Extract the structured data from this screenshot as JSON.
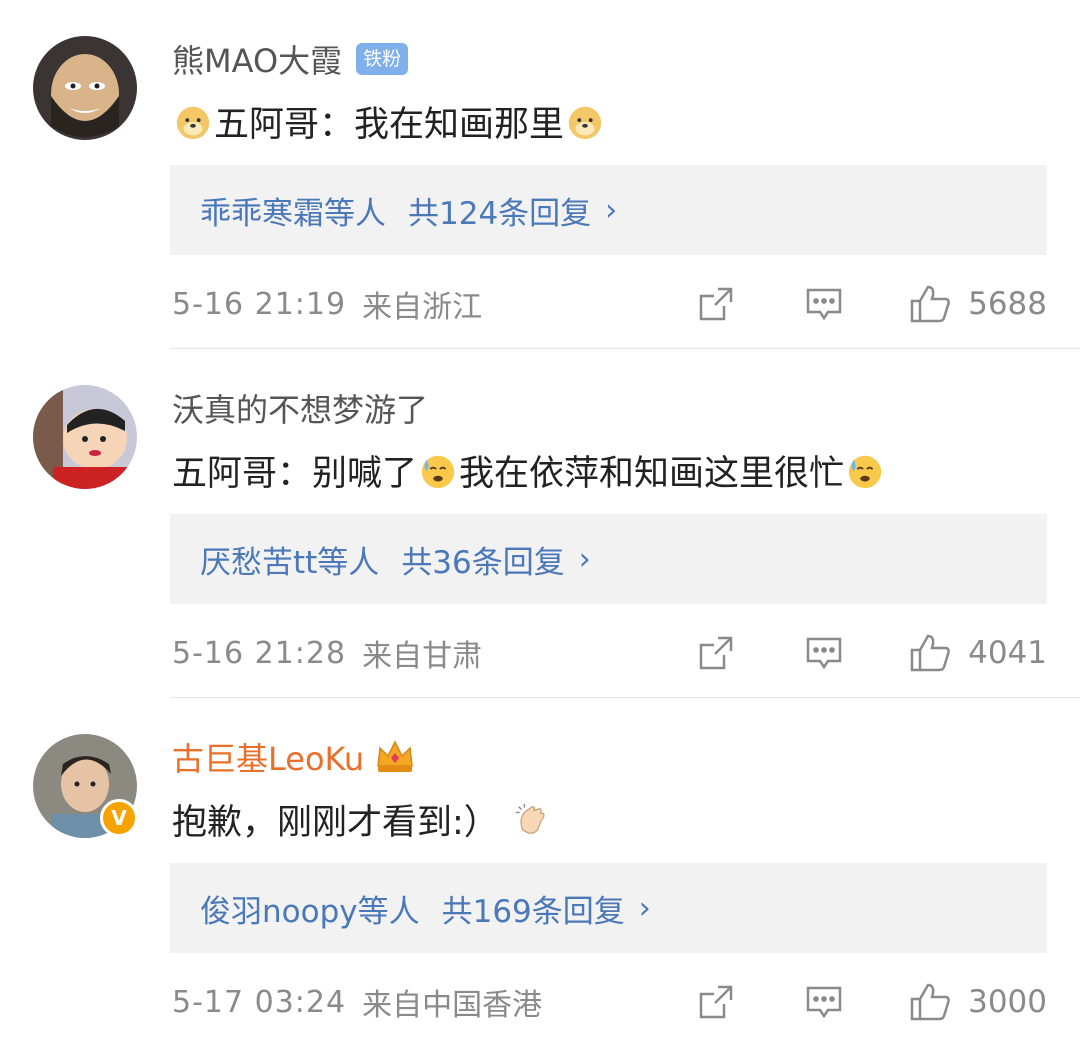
{
  "comments": [
    {
      "name": "熊MAO大霞",
      "badge": "铁粉",
      "text_parts": [
        "五阿哥：我在知画那里"
      ],
      "reply_users": "乖乖寒霜等人",
      "reply_count": "共124条回复",
      "time": "5-16 21:19",
      "location": "来自浙江",
      "likes": "5688"
    },
    {
      "name": "沃真的不想梦游了",
      "text_a": "五阿哥：别喊了",
      "text_b": "我在依萍和知画这里很忙",
      "reply_users": "厌愁苦tt等人",
      "reply_count": "共36条回复",
      "time": "5-16 21:28",
      "location": "来自甘肃",
      "likes": "4041"
    },
    {
      "name": "古巨基LeoKu",
      "verified": "V",
      "text": "抱歉，刚刚才看到:）",
      "reply_users": "俊羽noopy等人",
      "reply_count": "共169条回复",
      "time": "5-17 03:24",
      "location": "来自中国香港",
      "likes": "3000"
    }
  ],
  "colors": {
    "link": "#4a78b8",
    "vip_name": "#e8702a",
    "meta": "#8a8a8a",
    "fan_badge": "#7fb0ec"
  },
  "icons": [
    "doge-emoji",
    "sweat-emoji",
    "clap-emoji",
    "crown-icon",
    "share-icon",
    "comment-icon",
    "thumbs-up-icon",
    "chevron-right-icon"
  ]
}
